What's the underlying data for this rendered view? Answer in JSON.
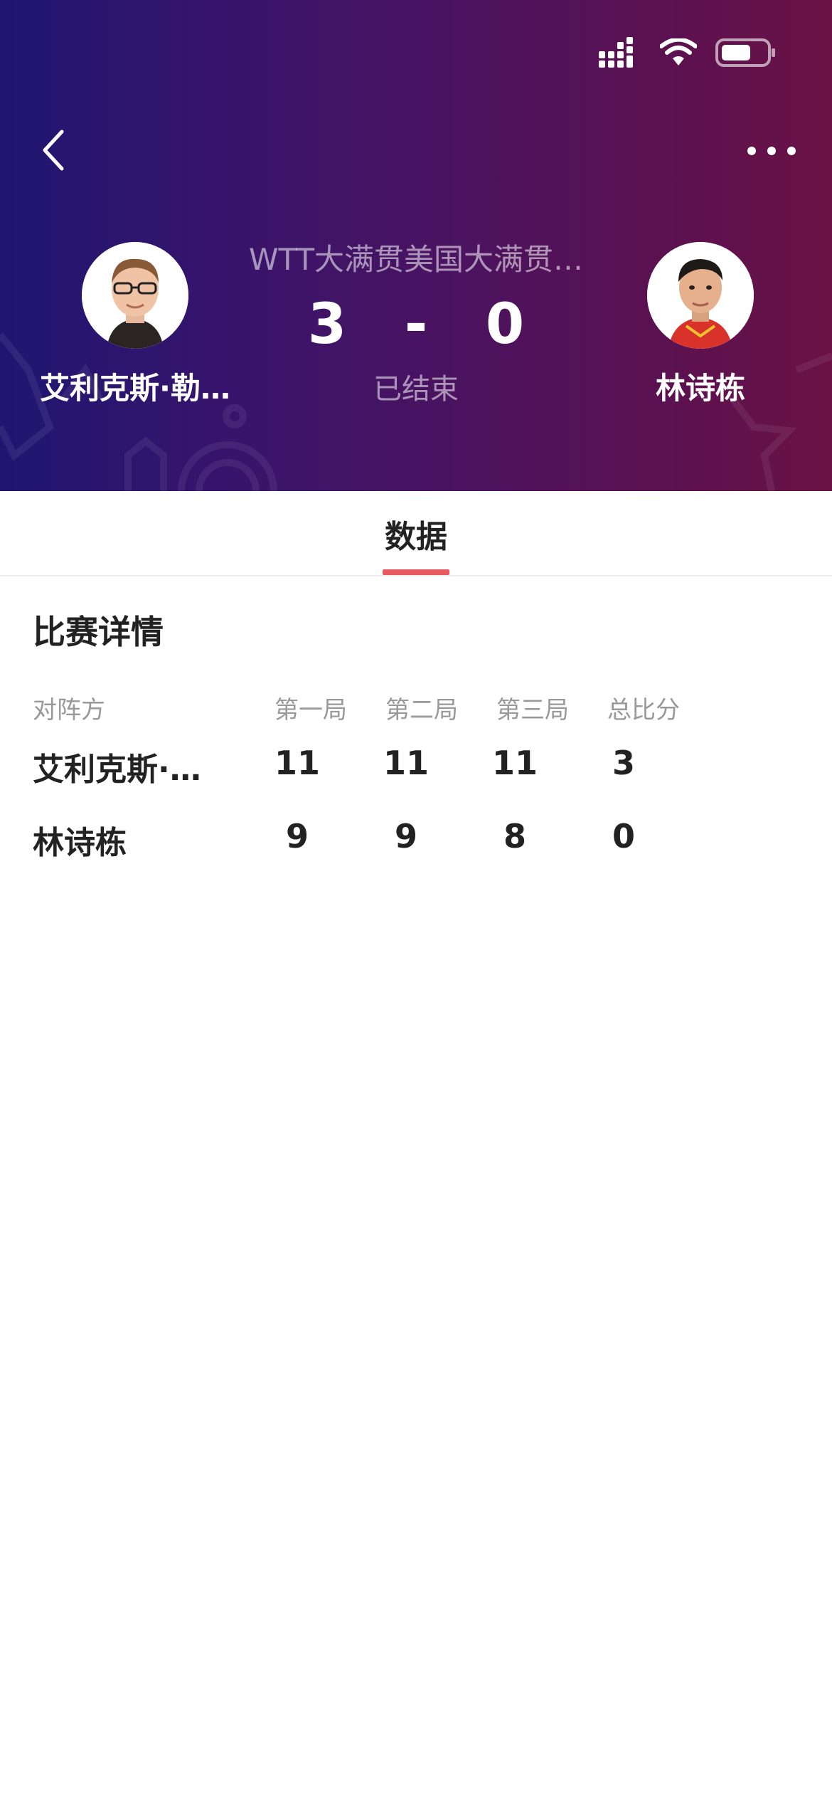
{
  "header": {
    "match_title": "WTT大满贯美国大满贯…",
    "home_score": "3",
    "separator": "-",
    "away_score": "0",
    "status": "已结束",
    "home_player": "艾利克斯·勒…",
    "away_player": "林诗栋"
  },
  "tabs": [
    {
      "label": "数据",
      "active": true
    }
  ],
  "details": {
    "title": "比赛详情",
    "columns": [
      "对阵方",
      "第一局",
      "第二局",
      "第三局",
      "总比分"
    ],
    "rows": [
      {
        "name": "艾利克斯·…",
        "scores": [
          "11",
          "11",
          "11",
          "3"
        ]
      },
      {
        "name": "林诗栋",
        "scores": [
          "9",
          "9",
          "8",
          "0"
        ]
      }
    ]
  },
  "icons": {
    "back": "chevron-left-icon",
    "more": "more-dots-icon",
    "signal": "signal-icon",
    "wifi": "wifi-icon",
    "battery": "battery-icon"
  },
  "colors": {
    "header_gradient_start": "#1f1671",
    "header_gradient_end": "#6a1246",
    "tab_indicator": "#e85a5f",
    "muted_text": "#999999"
  }
}
